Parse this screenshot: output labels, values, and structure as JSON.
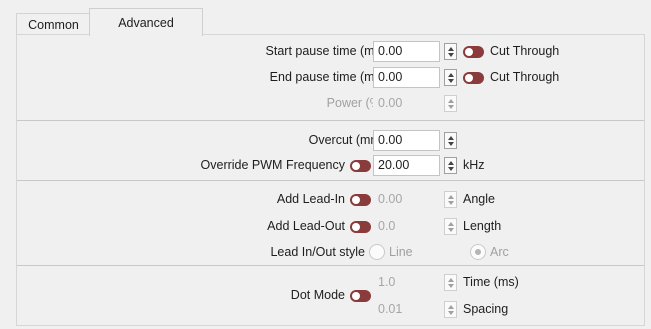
{
  "tabs": [
    {
      "label": "Common",
      "active": false
    },
    {
      "label": "Advanced",
      "active": true
    }
  ],
  "fields": {
    "start_pause": {
      "label": "Start pause time (ms)",
      "value": "0.00",
      "toggle_label": "Cut Through"
    },
    "end_pause": {
      "label": "End pause time (ms)",
      "value": "0.00",
      "toggle_label": "Cut Through"
    },
    "power": {
      "label": "Power (%)",
      "value": "0.00"
    },
    "overcut": {
      "label": "Overcut (mm)",
      "value": "0.00"
    },
    "override_pwm": {
      "label": "Override PWM Frequency",
      "value": "20.00",
      "unit": "kHz"
    },
    "lead_in": {
      "label": "Add Lead-In",
      "value": "0.00",
      "unit": "Angle"
    },
    "lead_out": {
      "label": "Add Lead-Out",
      "value": "0.0",
      "unit": "Length"
    },
    "lead_style": {
      "label": "Lead In/Out style",
      "options": [
        "Line",
        "Arc"
      ],
      "selected": "Arc"
    },
    "dot_mode": {
      "label": "Dot Mode",
      "time_value": "1.0",
      "time_unit": "Time (ms)",
      "spacing_value": "0.01",
      "spacing_unit": "Spacing"
    }
  },
  "colors": {
    "toggle": "#8a3b3b",
    "disabled_text": "#a0a0a0",
    "panel_bg": "#f0f0f0"
  }
}
